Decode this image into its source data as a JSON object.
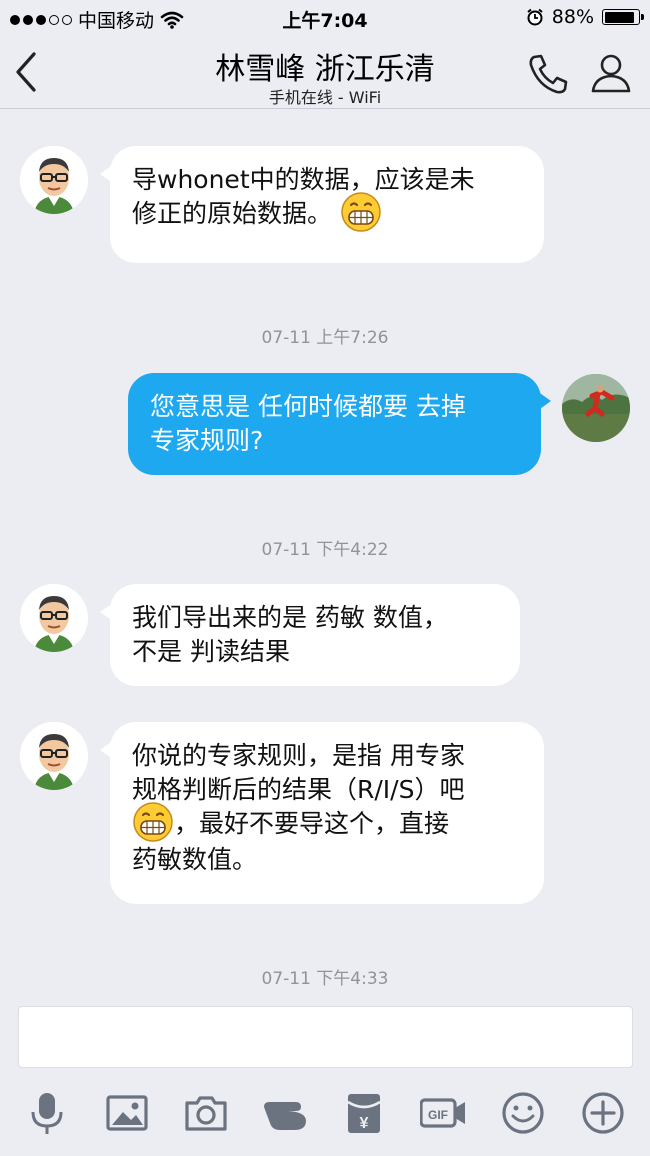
{
  "status_bar": {
    "carrier": "中国移动",
    "signal_bars": 3,
    "signal_total": 5,
    "time": "上午7:04",
    "battery_text": "88%",
    "battery_level": 0.88
  },
  "nav": {
    "title": "林雪峰 浙江乐清",
    "subtitle": "手机在线 - WiFi"
  },
  "messages": [
    {
      "sender": "other",
      "text_line1": "导whonet中的数据，应该是未",
      "text_line2": "修正的原始数据。",
      "emoji": "grin-emoji"
    },
    {
      "timestamp": "07-11 上午7:26"
    },
    {
      "sender": "self",
      "text_line1": "您意思是 任何时候都要 去掉",
      "text_line2": "专家规则?"
    },
    {
      "timestamp": "07-11 下午4:22"
    },
    {
      "sender": "other",
      "text_line1": "我们导出来的是 药敏 数值，",
      "text_line2": "不是 判读结果"
    },
    {
      "sender": "other",
      "text_line1": "你说的专家规则，是指 用专家",
      "text_line2": "规格判断后的结果（R/I/S）吧",
      "text_line3": "，最好不要导这个，直接",
      "text_line4": "药敏数值。",
      "emoji": "grin-emoji"
    },
    {
      "timestamp": "07-11 下午4:33"
    }
  ],
  "toolbar": [
    "microphone-icon",
    "image-icon",
    "camera-icon",
    "poke-icon",
    "red-packet-icon",
    "gif-icon",
    "smiley-icon",
    "plus-icon"
  ],
  "colors": {
    "background": "#ebedf2",
    "self_bubble": "#1ea8f0",
    "other_bubble": "#ffffff",
    "timestamp_text": "#8f939a",
    "icon_gray": "#6b7380"
  }
}
